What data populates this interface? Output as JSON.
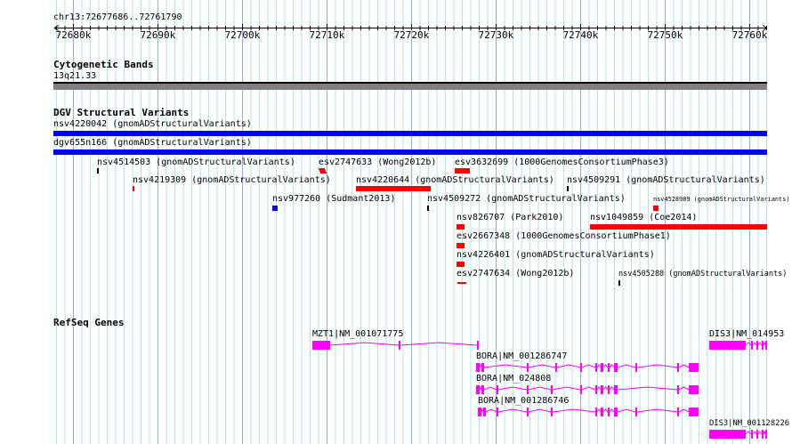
{
  "location": "chr13:72677686..72761790",
  "ruler_ticks": [
    "72680k",
    "72690k",
    "72700k",
    "72710k",
    "72720k",
    "72730k",
    "72740k",
    "72750k",
    "72760k"
  ],
  "tracks": {
    "cytobands": {
      "title": "Cytogenetic Bands",
      "band": "13q21.33"
    },
    "dgv": {
      "title": "DGV Structural Variants",
      "features": [
        "nsv4220042 (gnomADStructuralVariants)",
        "dgv655n166 (gnomADStructuralVariants)",
        "nsv4514503 (gnomADStructuralVariants)",
        "esv2747633 (Wong2012b)",
        "esv3632699 (1000GenomesConsortiumPhase3)",
        "nsv4219309 (gnomADStructuralVariants)",
        "nsv4220644 (gnomADStructuralVariants)",
        "nsv4509291 (gnomADStructuralVariants)",
        "nsv977260 (Sudmant2013)",
        "nsv4509272 (gnomADStructuralVariants)",
        "nsv4528989 (gnomADStructuralVariants)",
        "nsv826707 (Park2010)",
        "nsv1049859 (Coe2014)",
        "esv2667348 (1000GenomesConsortiumPhase1)",
        "nsv4226401 (gnomADStructuralVariants)",
        "esv2747634 (Wong2012b)",
        "nsv4505288 (gnomADStructuralVariants)"
      ]
    },
    "refseq": {
      "title": "RefSeq Genes",
      "genes": [
        "MZT1|NM_001071775",
        "DIS3|NM_014953",
        "BORA|NM_001286747",
        "BORA|NM_024808",
        "BORA|NM_001286746",
        "DIS3|NM_001128226"
      ]
    }
  },
  "colors": {
    "gain": "#ff0000",
    "loss": "#0000ff",
    "gene": "#ff00ff",
    "grid_minor": "#aee6ee",
    "grid_major": "#7fb8e6"
  }
}
